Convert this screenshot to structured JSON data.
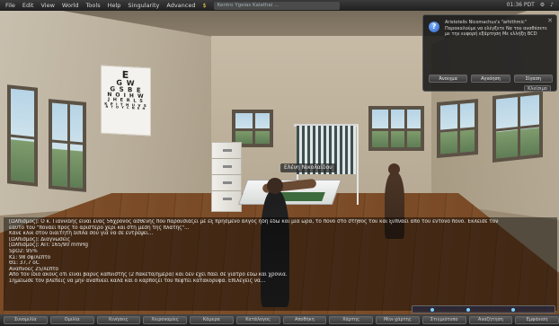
{
  "menubar": {
    "items": [
      "File",
      "Edit",
      "View",
      "World",
      "Tools",
      "Help",
      "Singularity",
      "Advanced",
      "$"
    ],
    "location": "Kentro Ygeias Kalathai ... ",
    "clock": "01:36 PDT",
    "icons": [
      "gear-icon",
      "volume-icon",
      "close-icon"
    ]
  },
  "scene": {
    "eye_chart_rows": [
      "E",
      "G W",
      "G S B E",
      "N O I H W",
      "J H E R L S",
      "K P I T H U V S",
      "R T O Y C N E H"
    ],
    "name_tag": "Ελένη Νικολαΐδου"
  },
  "notice": {
    "text": "Aristotelis Nicomachus's \"arhithmic\" Παρακαλούμε να ελέγξετε Να του αναθέσετε με την ευφορή εξάρτηση Με ελλήξη BCD",
    "buttons": [
      "Άνοιγμα",
      "Αγνόηση",
      "Σίγαση"
    ],
    "ok": "Κλείσιμο"
  },
  "chat": {
    "lines": [
      "[Ωλπισμός]: Ο κ. Γιαννίδης είναι ένας 56χρονος ασθενής που παρουσιάζει με εξ πρησμένο άλγος ήδη εδώ και μια ώρα, το πόνο στο στήθος του και ξυπνάει από του έντονο πόνο. Έκλεισε τον",
      "εαυτό του \"πονάει προς το αριστερό χέρι και στη μέση της πλάτης\"...",
      "Κάνε κλικ στον διαιτητή δίπλα σου για να σε εντρέψει...",
      "[Ωλπισμός]: Διαγνώσεις",
      "[Ωλπισμός]: ΑΠ: 165/90 mmHg",
      "SpO2: 95%",
      "ΚΣ: 98 σφ/λεπτό",
      "ΘΣ: 37,7 οC",
      "Αναπνοές 25/λεπτό",
      "Από τον ίδιο ακούς ότι είναι βαρύς καπνιστής (2 πακέτα/ημέρα) και δεν έχει πάει σε γιατρό εδώ και χρόνια.",
      "Σημείωσε τον βλέπεις να μην αναπνέει καλά και ο καρπόζεί του πέφτει κατακόρυφα. Επιλέγεις να..."
    ]
  },
  "bottombar": {
    "buttons": [
      "Συνομιλία",
      "Ομιλία",
      "Κινήσεις",
      "Χειρονομίες",
      "Κάμερα",
      "Κατάλογος",
      "Αποθήκη",
      "Χάρτης",
      "Μίνι-χάρτης",
      "Στιγμιότυπο",
      "Αναζήτηση",
      "Εμφάνιση"
    ]
  },
  "colors": {
    "menubar": "#2a2a2a",
    "chat_text": "#e8e8e8",
    "notice_bg": "#191919"
  }
}
